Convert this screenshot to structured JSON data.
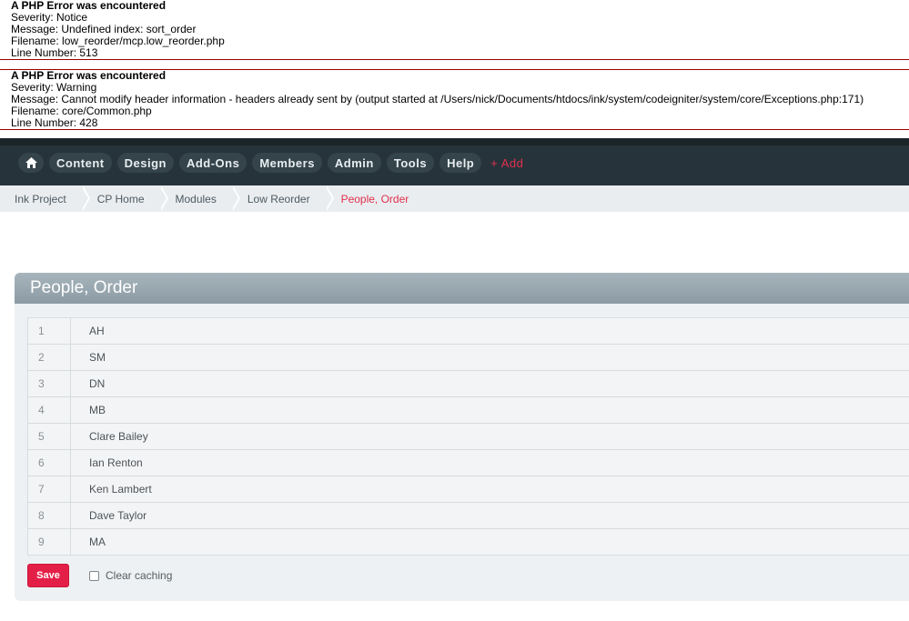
{
  "errors": [
    {
      "title": "A PHP Error was encountered",
      "severity": "Severity: Notice",
      "message": "Message: Undefined index: sort_order",
      "filename": "Filename: low_reorder/mcp.low_reorder.php",
      "line": "Line Number: 513"
    },
    {
      "title": "A PHP Error was encountered",
      "severity": "Severity: Warning",
      "message": "Message: Cannot modify header information - headers already sent by (output started at /Users/nick/Documents/htdocs/ink/system/codeigniter/system/core/Exceptions.php:171)",
      "filename": "Filename: core/Common.php",
      "line": "Line Number: 428"
    }
  ],
  "nav": {
    "home_icon": "home-icon",
    "items": [
      "Content",
      "Design",
      "Add-Ons",
      "Members",
      "Admin",
      "Tools",
      "Help"
    ],
    "add_label": "+ Add"
  },
  "breadcrumb": [
    "Ink Project",
    "CP Home",
    "Modules",
    "Low Reorder",
    "People, Order"
  ],
  "panel": {
    "title": "People, Order",
    "rows": [
      {
        "num": "1",
        "name": "AH"
      },
      {
        "num": "2",
        "name": "SM"
      },
      {
        "num": "3",
        "name": "DN"
      },
      {
        "num": "4",
        "name": "MB"
      },
      {
        "num": "5",
        "name": "Clare Bailey"
      },
      {
        "num": "6",
        "name": "Ian Renton"
      },
      {
        "num": "7",
        "name": "Ken Lambert"
      },
      {
        "num": "8",
        "name": "Dave Taylor"
      },
      {
        "num": "9",
        "name": "MA"
      }
    ],
    "save_label": "Save",
    "clear_caching_label": "Clear caching"
  },
  "colors": {
    "accent": "#e41f47",
    "topbar": "#27333a",
    "error_border": "#990000"
  }
}
